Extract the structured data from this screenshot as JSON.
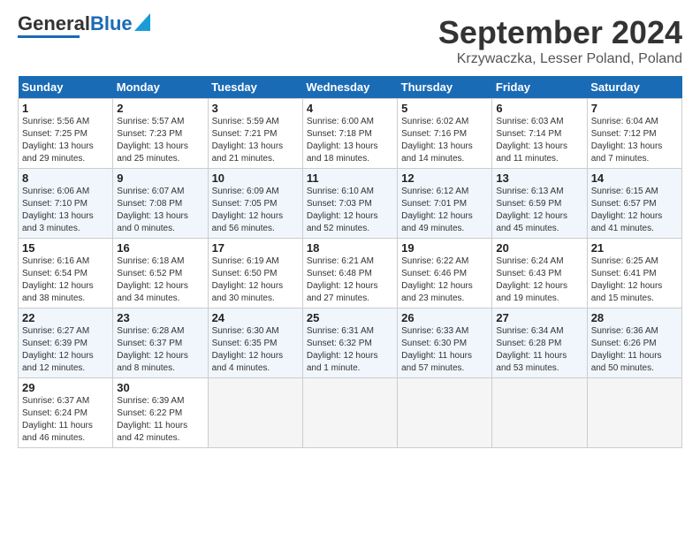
{
  "header": {
    "logo_main": "General",
    "logo_sub": "Blue",
    "month": "September 2024",
    "location": "Krzywaczka, Lesser Poland, Poland"
  },
  "days_of_week": [
    "Sunday",
    "Monday",
    "Tuesday",
    "Wednesday",
    "Thursday",
    "Friday",
    "Saturday"
  ],
  "weeks": [
    [
      {
        "day": "1",
        "info": "Sunrise: 5:56 AM\nSunset: 7:25 PM\nDaylight: 13 hours\nand 29 minutes."
      },
      {
        "day": "2",
        "info": "Sunrise: 5:57 AM\nSunset: 7:23 PM\nDaylight: 13 hours\nand 25 minutes."
      },
      {
        "day": "3",
        "info": "Sunrise: 5:59 AM\nSunset: 7:21 PM\nDaylight: 13 hours\nand 21 minutes."
      },
      {
        "day": "4",
        "info": "Sunrise: 6:00 AM\nSunset: 7:18 PM\nDaylight: 13 hours\nand 18 minutes."
      },
      {
        "day": "5",
        "info": "Sunrise: 6:02 AM\nSunset: 7:16 PM\nDaylight: 13 hours\nand 14 minutes."
      },
      {
        "day": "6",
        "info": "Sunrise: 6:03 AM\nSunset: 7:14 PM\nDaylight: 13 hours\nand 11 minutes."
      },
      {
        "day": "7",
        "info": "Sunrise: 6:04 AM\nSunset: 7:12 PM\nDaylight: 13 hours\nand 7 minutes."
      }
    ],
    [
      {
        "day": "8",
        "info": "Sunrise: 6:06 AM\nSunset: 7:10 PM\nDaylight: 13 hours\nand 3 minutes."
      },
      {
        "day": "9",
        "info": "Sunrise: 6:07 AM\nSunset: 7:08 PM\nDaylight: 13 hours\nand 0 minutes."
      },
      {
        "day": "10",
        "info": "Sunrise: 6:09 AM\nSunset: 7:05 PM\nDaylight: 12 hours\nand 56 minutes."
      },
      {
        "day": "11",
        "info": "Sunrise: 6:10 AM\nSunset: 7:03 PM\nDaylight: 12 hours\nand 52 minutes."
      },
      {
        "day": "12",
        "info": "Sunrise: 6:12 AM\nSunset: 7:01 PM\nDaylight: 12 hours\nand 49 minutes."
      },
      {
        "day": "13",
        "info": "Sunrise: 6:13 AM\nSunset: 6:59 PM\nDaylight: 12 hours\nand 45 minutes."
      },
      {
        "day": "14",
        "info": "Sunrise: 6:15 AM\nSunset: 6:57 PM\nDaylight: 12 hours\nand 41 minutes."
      }
    ],
    [
      {
        "day": "15",
        "info": "Sunrise: 6:16 AM\nSunset: 6:54 PM\nDaylight: 12 hours\nand 38 minutes."
      },
      {
        "day": "16",
        "info": "Sunrise: 6:18 AM\nSunset: 6:52 PM\nDaylight: 12 hours\nand 34 minutes."
      },
      {
        "day": "17",
        "info": "Sunrise: 6:19 AM\nSunset: 6:50 PM\nDaylight: 12 hours\nand 30 minutes."
      },
      {
        "day": "18",
        "info": "Sunrise: 6:21 AM\nSunset: 6:48 PM\nDaylight: 12 hours\nand 27 minutes."
      },
      {
        "day": "19",
        "info": "Sunrise: 6:22 AM\nSunset: 6:46 PM\nDaylight: 12 hours\nand 23 minutes."
      },
      {
        "day": "20",
        "info": "Sunrise: 6:24 AM\nSunset: 6:43 PM\nDaylight: 12 hours\nand 19 minutes."
      },
      {
        "day": "21",
        "info": "Sunrise: 6:25 AM\nSunset: 6:41 PM\nDaylight: 12 hours\nand 15 minutes."
      }
    ],
    [
      {
        "day": "22",
        "info": "Sunrise: 6:27 AM\nSunset: 6:39 PM\nDaylight: 12 hours\nand 12 minutes."
      },
      {
        "day": "23",
        "info": "Sunrise: 6:28 AM\nSunset: 6:37 PM\nDaylight: 12 hours\nand 8 minutes."
      },
      {
        "day": "24",
        "info": "Sunrise: 6:30 AM\nSunset: 6:35 PM\nDaylight: 12 hours\nand 4 minutes."
      },
      {
        "day": "25",
        "info": "Sunrise: 6:31 AM\nSunset: 6:32 PM\nDaylight: 12 hours\nand 1 minute."
      },
      {
        "day": "26",
        "info": "Sunrise: 6:33 AM\nSunset: 6:30 PM\nDaylight: 11 hours\nand 57 minutes."
      },
      {
        "day": "27",
        "info": "Sunrise: 6:34 AM\nSunset: 6:28 PM\nDaylight: 11 hours\nand 53 minutes."
      },
      {
        "day": "28",
        "info": "Sunrise: 6:36 AM\nSunset: 6:26 PM\nDaylight: 11 hours\nand 50 minutes."
      }
    ],
    [
      {
        "day": "29",
        "info": "Sunrise: 6:37 AM\nSunset: 6:24 PM\nDaylight: 11 hours\nand 46 minutes."
      },
      {
        "day": "30",
        "info": "Sunrise: 6:39 AM\nSunset: 6:22 PM\nDaylight: 11 hours\nand 42 minutes."
      },
      {
        "day": "",
        "info": ""
      },
      {
        "day": "",
        "info": ""
      },
      {
        "day": "",
        "info": ""
      },
      {
        "day": "",
        "info": ""
      },
      {
        "day": "",
        "info": ""
      }
    ]
  ]
}
